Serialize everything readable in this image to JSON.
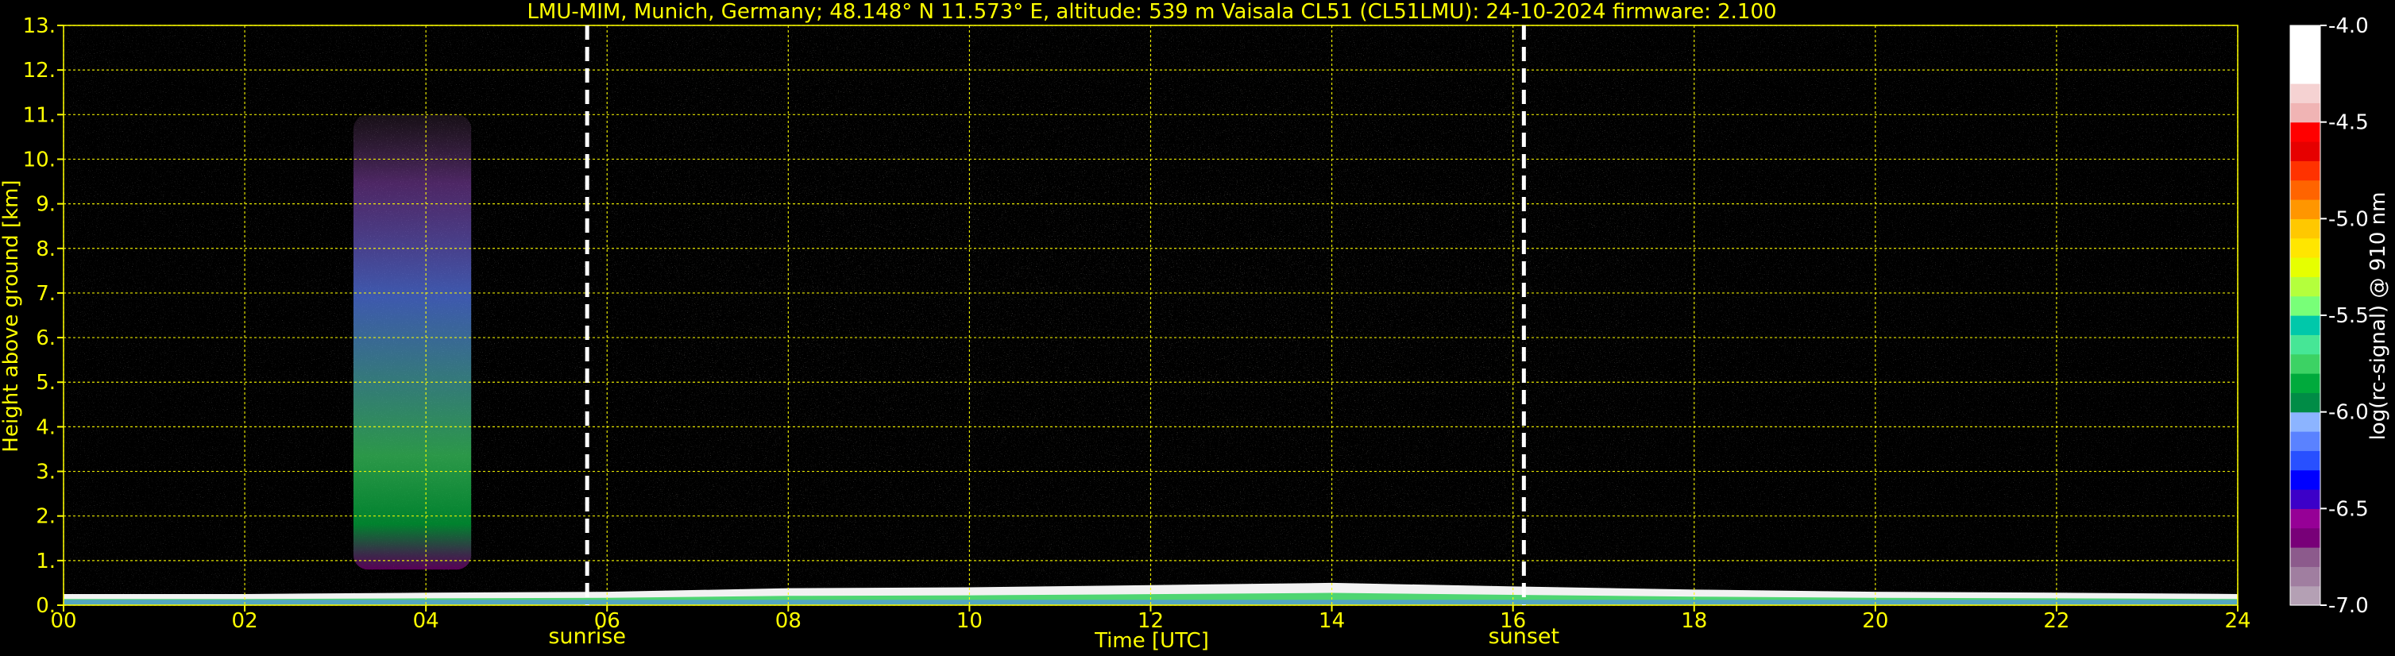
{
  "chart_data": {
    "type": "heatmap",
    "title": "LMU-MIM, Munich, Germany; 48.148° N 11.573° E, altitude: 539 m    Vaisala CL51 (CL51LMU): 24-10-2024    firmware: 2.100",
    "xlabel": "Time [UTC]",
    "ylabel": "Height above ground [km]",
    "xlim": [
      0,
      24
    ],
    "ylim": [
      0,
      13
    ],
    "xticks": [
      "00",
      "02",
      "04",
      "06",
      "08",
      "10",
      "12",
      "14",
      "16",
      "18",
      "20",
      "22",
      "24"
    ],
    "yticks": [
      "0.",
      "1.",
      "2.",
      "3.",
      "4.",
      "5.",
      "6.",
      "7.",
      "8.",
      "9.",
      "10.",
      "11.",
      "12.",
      "13."
    ],
    "grid": true,
    "colorbar": {
      "label": "log(rc-signal) @ 910 nm",
      "range": [
        -7.0,
        -4.0
      ],
      "ticks": [
        "-4.0",
        "-4.5",
        "-5.0",
        "-5.5",
        "-6.0",
        "-6.5",
        "-7.0"
      ],
      "colors": [
        "#b4a0b4",
        "#a07ea0",
        "#8c5a8c",
        "#780078",
        "#960096",
        "#3c00c8",
        "#0000ff",
        "#2850ff",
        "#5a82ff",
        "#8cb4ff",
        "#008c46",
        "#00aa3c",
        "#3cd264",
        "#46e696",
        "#00c8aa",
        "#78ff78",
        "#b4ff3c",
        "#e6ff00",
        "#ffe600",
        "#ffc800",
        "#ff9600",
        "#ff6400",
        "#ff3200",
        "#e60000",
        "#ff0000",
        "#f0b4b4",
        "#f5d2d2",
        "#ffffff",
        "#ffffff",
        "#ffffff"
      ]
    },
    "events": [
      {
        "label": "sunrise",
        "time": 5.78
      },
      {
        "label": "sunset",
        "time": 16.12
      }
    ],
    "features": [
      {
        "name": "aerosol-layer",
        "t_start": 0,
        "t_end": 24,
        "top_km": [
          0.25,
          0.25,
          0.28,
          0.3,
          0.38,
          0.4,
          0.45,
          0.5,
          0.42,
          0.35,
          0.3,
          0.28,
          0.25
        ]
      },
      {
        "name": "cloud-band",
        "t_start": 3.2,
        "t_end": 4.5,
        "base_km": 0.8,
        "top_km": 11.0
      }
    ]
  }
}
